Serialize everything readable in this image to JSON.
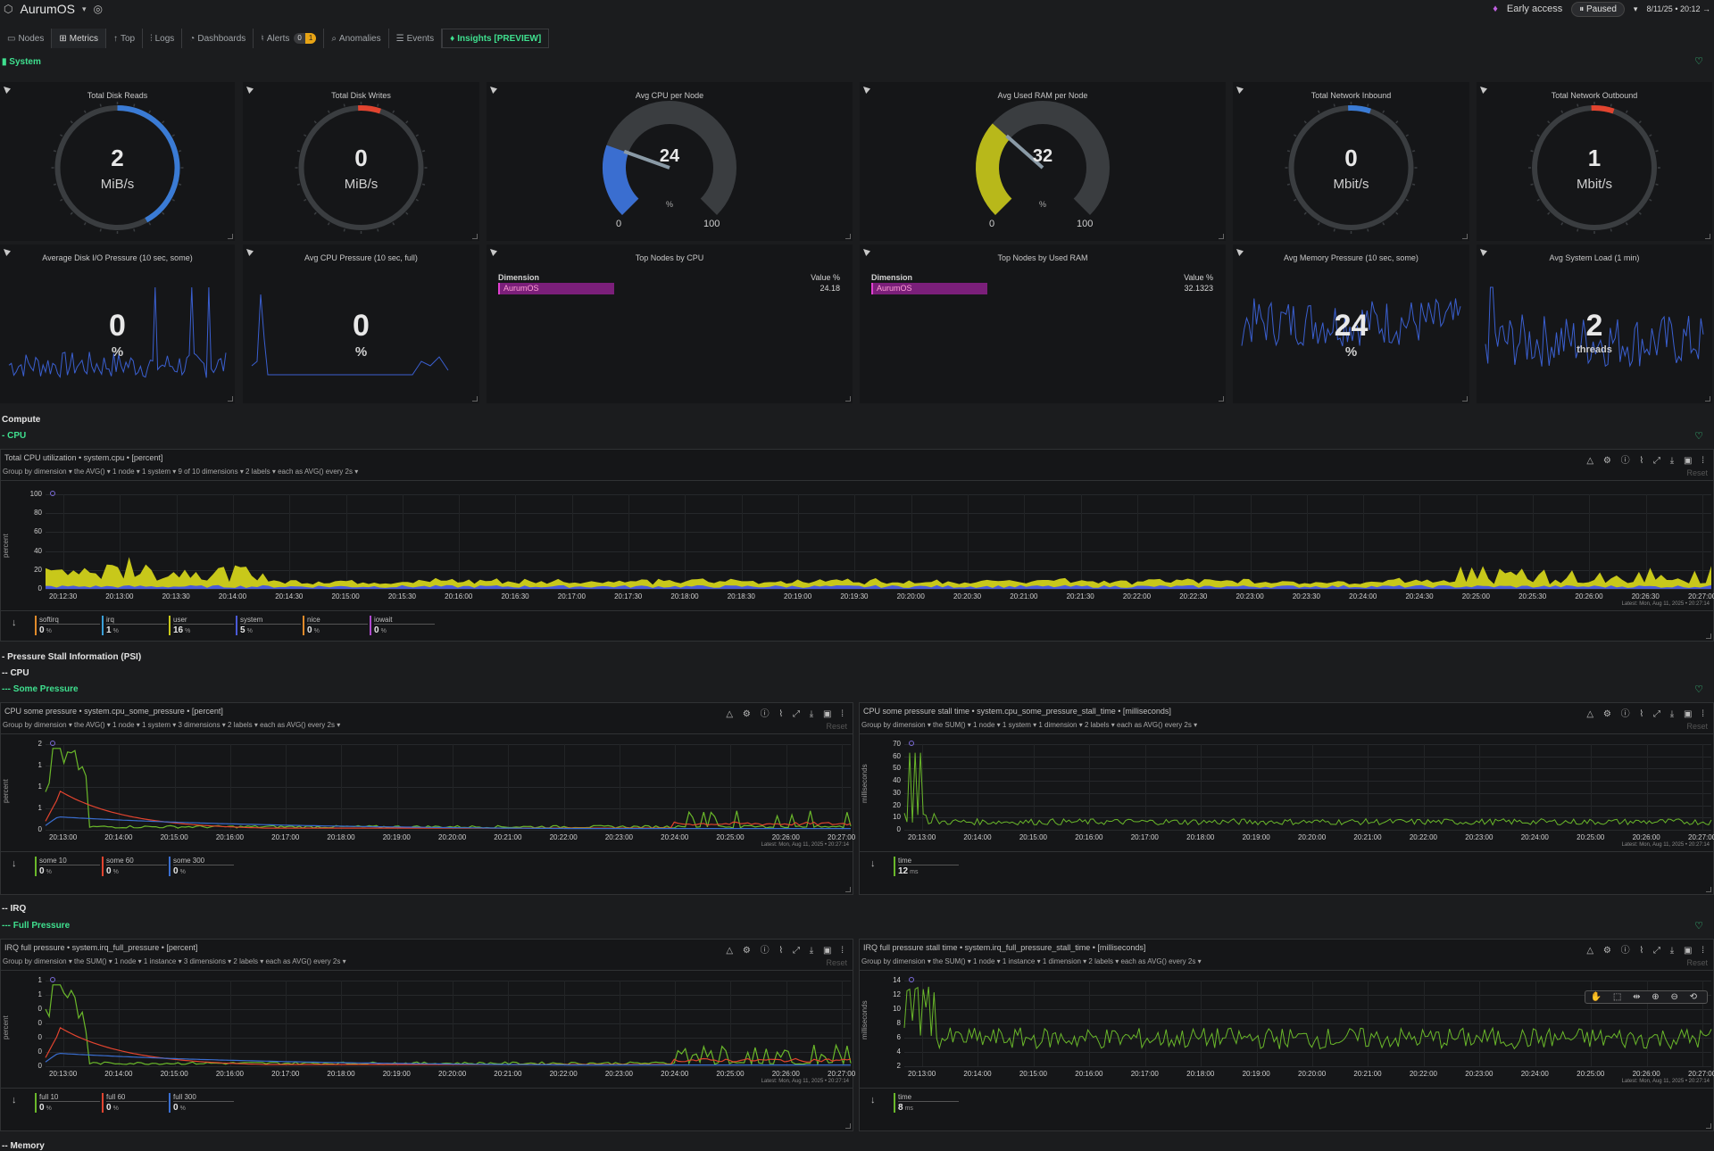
{
  "app": {
    "name": "AurumOS",
    "early_access": "Early access",
    "paused": "Paused",
    "datetime": "8/11/25 • 20:12 →"
  },
  "tabs": [
    {
      "label": "Nodes"
    },
    {
      "label": "Metrics"
    },
    {
      "label": "Top"
    },
    {
      "label": "Logs"
    },
    {
      "label": "Dashboards"
    },
    {
      "label": "Alerts"
    },
    {
      "label": "Anomalies"
    },
    {
      "label": "Events"
    },
    {
      "label": "Insights [PREVIEW]"
    }
  ],
  "alerts_badge": {
    "count0": "0",
    "count1": "1"
  },
  "sections": {
    "system": "System",
    "compute": "Compute",
    "cpu": "- CPU",
    "psi": "- Pressure Stall Information (PSI)",
    "psi_cpu": "-- CPU",
    "some_pressure": "--- Some Pressure",
    "irq": "-- IRQ",
    "full_pressure": "--- Full Pressure",
    "memory": "-- Memory"
  },
  "gauges": [
    {
      "title": "Total Disk Reads",
      "value": "2",
      "unit": "MiB/s",
      "color": "#3a7bd5",
      "fraction": 0.42
    },
    {
      "title": "Total Disk Writes",
      "value": "0",
      "unit": "MiB/s",
      "color": "#e2442f",
      "fraction": 0.02
    },
    {
      "title": "Avg CPU per Node",
      "value": "24",
      "unit": "%",
      "min": "0",
      "max": "100",
      "color": "#3a6ed0",
      "fraction": 0.24
    },
    {
      "title": "Avg Used RAM per Node",
      "value": "32",
      "unit": "%",
      "min": "0",
      "max": "100",
      "color": "#b8b81a",
      "fraction": 0.32
    },
    {
      "title": "Total Network Inbound",
      "value": "0",
      "unit": "Mbit/s",
      "color": "#3a7bd5",
      "fraction": 0.02
    },
    {
      "title": "Total Network Outbound",
      "value": "1",
      "unit": "Mbit/s",
      "color": "#e2442f",
      "fraction": 0.03
    }
  ],
  "row2": [
    {
      "title": "Average Disk I/O Pressure (10 sec, some)",
      "value": "0",
      "unit": "%"
    },
    {
      "title": "Avg CPU Pressure (10 sec, full)",
      "value": "0",
      "unit": "%"
    },
    {
      "title": "Top Nodes by CPU",
      "dim_header": "Dimension",
      "val_header": "Value %",
      "dim": "AurumOS",
      "val": "24.18"
    },
    {
      "title": "Top Nodes by Used RAM",
      "dim_header": "Dimension",
      "val_header": "Value %",
      "dim": "AurumOS",
      "val": "32.1323"
    },
    {
      "title": "Avg Memory Pressure (10 sec, some)",
      "value": "24",
      "unit": "%"
    },
    {
      "title": "Avg System Load (1 min)",
      "value": "2",
      "unit": "threads"
    }
  ],
  "cpu_panel": {
    "title": "Total CPU utilization • system.cpu • [percent]",
    "group": "Group by dimension ▾   the AVG() ▾   1 node ▾   1 system ▾   9 of 10 dimensions ▾   2 labels ▾   each as AVG() every 2s ▾",
    "reset": "Reset",
    "ylabel": "percent",
    "latest": "Latest: Mon, Aug 11, 2025 • 20:27:14",
    "yticks": [
      "100",
      "80",
      "60",
      "40",
      "20",
      "0"
    ],
    "xticks": [
      "20:12:30",
      "20:13:00",
      "20:13:30",
      "20:14:00",
      "20:14:30",
      "20:15:00",
      "20:15:30",
      "20:16:00",
      "20:16:30",
      "20:17:00",
      "20:17:30",
      "20:18:00",
      "20:18:30",
      "20:19:00",
      "20:19:30",
      "20:20:00",
      "20:20:30",
      "20:21:00",
      "20:21:30",
      "20:22:00",
      "20:22:30",
      "20:23:00",
      "20:23:30",
      "20:24:00",
      "20:24:30",
      "20:25:00",
      "20:25:30",
      "20:26:00",
      "20:26:30",
      "20:27:00"
    ],
    "legend": [
      {
        "name": "softirq",
        "value": "0",
        "unit": "%",
        "color": "#e08a2a"
      },
      {
        "name": "irq",
        "value": "1",
        "unit": "%",
        "color": "#3aa0d8"
      },
      {
        "name": "user",
        "value": "16",
        "unit": "%",
        "color": "#c8c81a"
      },
      {
        "name": "system",
        "value": "5",
        "unit": "%",
        "color": "#4a5ad8"
      },
      {
        "name": "nice",
        "value": "0",
        "unit": "%",
        "color": "#e08a2a"
      },
      {
        "name": "iowait",
        "value": "0",
        "unit": "%",
        "color": "#b04ad0"
      }
    ]
  },
  "psi_some": {
    "title": "CPU some pressure • system.cpu_some_pressure • [percent]",
    "group": "Group by dimension ▾   the AVG() ▾   1 node ▾   1 system ▾   3 dimensions ▾   2 labels ▾   each as AVG() every 2s ▾",
    "ylabel": "percent",
    "yticks": [
      "2",
      "1",
      "1",
      "1",
      "0"
    ],
    "legend": [
      {
        "name": "some 10",
        "value": "0",
        "unit": "%",
        "color": "#6ab82a"
      },
      {
        "name": "some 60",
        "value": "0",
        "unit": "%",
        "color": "#e2442f"
      },
      {
        "name": "some 300",
        "value": "0",
        "unit": "%",
        "color": "#3a6ed0"
      }
    ]
  },
  "psi_some_time": {
    "title": "CPU some pressure stall time • system.cpu_some_pressure_stall_time • [milliseconds]",
    "group": "Group by dimension ▾   the SUM() ▾   1 node ▾   1 system ▾   1 dimension ▾   2 labels ▾   each as AVG() every 2s ▾",
    "ylabel": "milliseconds",
    "yticks": [
      "70",
      "60",
      "50",
      "40",
      "30",
      "20",
      "10",
      "0"
    ],
    "legend": [
      {
        "name": "time",
        "value": "12",
        "unit": "ms",
        "color": "#6ab82a"
      }
    ]
  },
  "irq_full": {
    "title": "IRQ full pressure • system.irq_full_pressure • [percent]",
    "group": "Group by dimension ▾   the SUM() ▾   1 node ▾   1 instance ▾   3 dimensions ▾   2 labels ▾   each as AVG() every 2s ▾",
    "ylabel": "percent",
    "yticks": [
      "1",
      "1",
      "0",
      "0",
      "0",
      "0",
      "0"
    ],
    "legend": [
      {
        "name": "full 10",
        "value": "0",
        "unit": "%",
        "color": "#6ab82a"
      },
      {
        "name": "full 60",
        "value": "0",
        "unit": "%",
        "color": "#e2442f"
      },
      {
        "name": "full 300",
        "value": "0",
        "unit": "%",
        "color": "#3a6ed0"
      }
    ]
  },
  "irq_full_time": {
    "title": "IRQ full pressure stall time • system.irq_full_pressure_stall_time • [milliseconds]",
    "group": "Group by dimension ▾   the SUM() ▾   1 node ▾   1 instance ▾   1 dimension ▾   2 labels ▾   each as AVG() every 2s ▾",
    "ylabel": "milliseconds",
    "yticks": [
      "14",
      "12",
      "10",
      "8",
      "6",
      "4",
      "2"
    ],
    "legend": [
      {
        "name": "time",
        "value": "8",
        "unit": "ms",
        "color": "#6ab82a"
      }
    ]
  },
  "half_xticks": [
    "20:13:00",
    "20:14:00",
    "20:15:00",
    "20:16:00",
    "20:17:00",
    "20:18:00",
    "20:19:00",
    "20:20:00",
    "20:21:00",
    "20:22:00",
    "20:23:00",
    "20:24:00",
    "20:25:00",
    "20:26:00",
    "20:27:00"
  ],
  "latest_short": "Latest: Mon, Aug 11, 2025 • 20:27:14",
  "reset": "Reset"
}
